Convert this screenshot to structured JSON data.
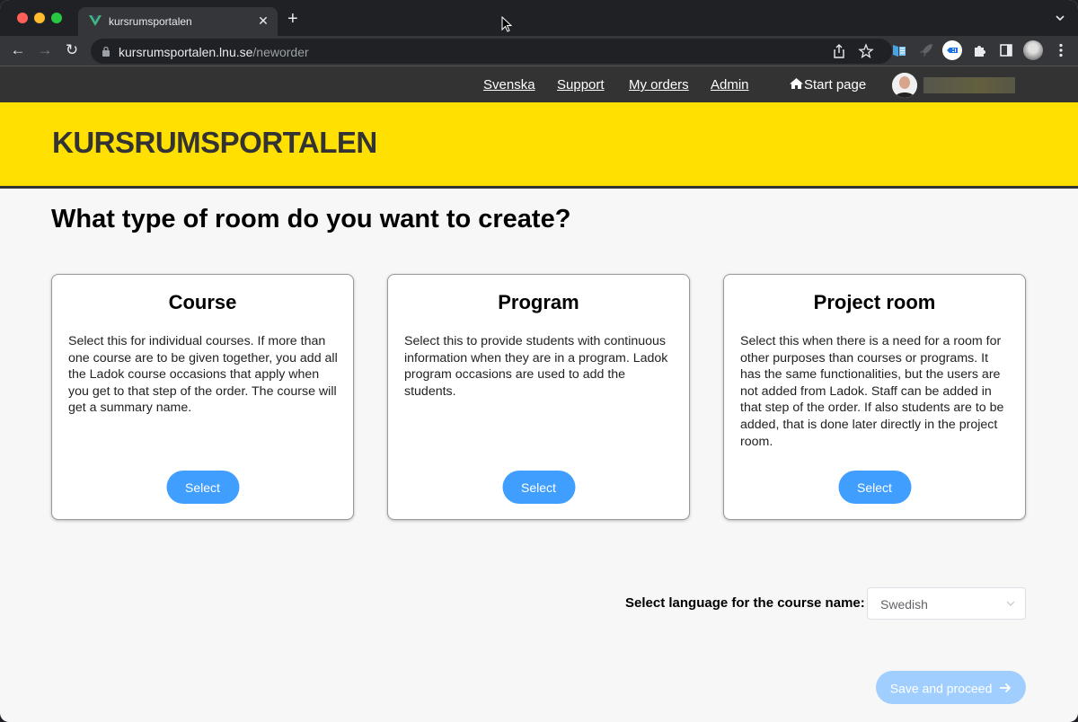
{
  "browser": {
    "tab_title": "kursrumsportalen",
    "url_host": "kursrumsportalen.lnu.se",
    "url_path": "/neworder",
    "new_tab_label": "+",
    "close_tab_label": "✕"
  },
  "site_nav": {
    "links": [
      {
        "label": "Svenska"
      },
      {
        "label": "Support"
      },
      {
        "label": "My orders"
      },
      {
        "label": "Admin"
      }
    ],
    "start_page_label": "Start page"
  },
  "banner": {
    "title": "KURSRUMSPORTALEN",
    "color": "#ffe000"
  },
  "main": {
    "title": "What type of room do you want to create?",
    "cards": [
      {
        "title": "Course",
        "description": "Select this for individual courses. If more than one course are to be given together, you add all the Ladok course occasions that apply when you get to that step of the order. The course will get a summary name.",
        "button_label": "Select"
      },
      {
        "title": "Program",
        "description": "Select this to provide students with continuous information when they are in a program. Ladok program occasions are used to add the students.",
        "button_label": "Select"
      },
      {
        "title": "Project room",
        "description": "Select this when there is a need for a room for other purposes than courses or programs. It has the same functionalities, but the users are not added from Ladok. Staff can be added in that step of the order. If also students are to be added, that is done later directly in the project room.",
        "button_label": "Select"
      }
    ],
    "language": {
      "label": "Select language for the course name:",
      "selected": "Swedish"
    },
    "save_button_label": "Save and proceed",
    "accent_color": "#409eff"
  }
}
